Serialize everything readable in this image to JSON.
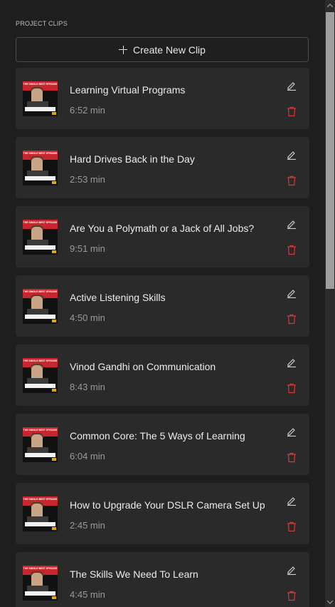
{
  "section": {
    "title": "PROJECT CLIPS"
  },
  "create_button": {
    "label": "Create New Clip",
    "icon": "plus-icon"
  },
  "clips": [
    {
      "title": "Learning Virtual Programs",
      "duration": "6:52 min",
      "thumb_banner": "THE SINGLE BEST EPISODE"
    },
    {
      "title": "Hard Drives Back in the Day",
      "duration": "2:53 min",
      "thumb_banner": "THE SINGLE BEST EPISODE"
    },
    {
      "title": "Are You a Polymath or a Jack of All Jobs?",
      "duration": "9:51 min",
      "thumb_banner": "THE SINGLE BEST EPISODE"
    },
    {
      "title": "Active Listening Skills",
      "duration": "4:50 min",
      "thumb_banner": "THE SINGLE BEST EPISODE"
    },
    {
      "title": "Vinod Gandhi on Communication",
      "duration": "8:43 min",
      "thumb_banner": "THE SINGLE BEST EPISODE"
    },
    {
      "title": "Common Core: The 5 Ways of Learning",
      "duration": "6:04 min",
      "thumb_banner": "THE SINGLE BEST EPISODE"
    },
    {
      "title": "How to Upgrade Your DSLR Camera Set Up",
      "duration": "2:45 min",
      "thumb_banner": "THE SINGLE BEST EPISODE"
    },
    {
      "title": "The Skills We Need To Learn",
      "duration": "4:45 min",
      "thumb_banner": "THE SINGLE BEST EPISODE"
    }
  ],
  "colors": {
    "background": "#1e1e1e",
    "card": "#2a2a2a",
    "delete": "#d83a3a",
    "edit": "#d0d0d0",
    "scrollbar_thumb": "#9e9e9e"
  },
  "icons": {
    "edit": "pencil-icon",
    "delete": "trash-icon"
  }
}
